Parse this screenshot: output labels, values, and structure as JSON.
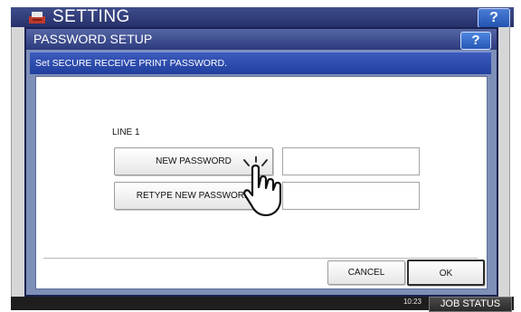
{
  "background": {
    "title": "SETTING",
    "help_label": "?",
    "clock": "10:23",
    "job_status_label": "JOB STATUS"
  },
  "dialog": {
    "title": "PASSWORD SETUP",
    "help_label": "?",
    "message": "Set SECURE RECEIVE PRINT PASSWORD.",
    "line_label": "LINE 1",
    "new_password_label": "NEW PASSWORD",
    "new_password_value": "",
    "retype_label": "RETYPE NEW PASSWORD",
    "retype_value": "",
    "cancel_label": "CANCEL",
    "ok_label": "OK"
  },
  "colors": {
    "title_bar": "#2c3a7c",
    "message_bar": "#203f9e",
    "dialog_frame": "#7e8fb8",
    "help_button": "#2557b6"
  },
  "icons": [
    "printer-logo-icon",
    "pointing-hand-icon"
  ]
}
